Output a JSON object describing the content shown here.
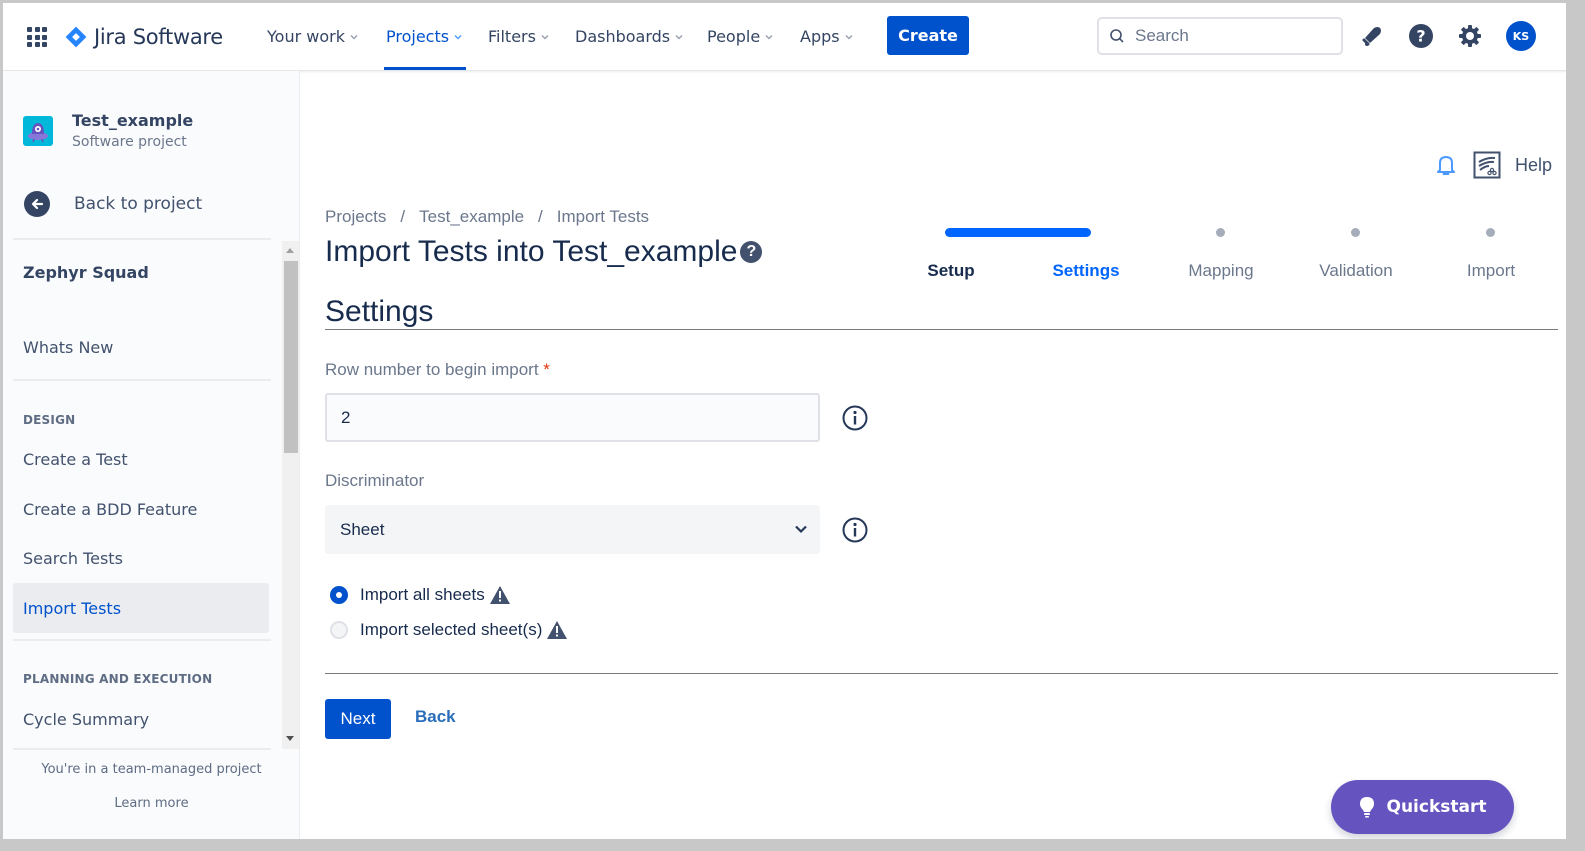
{
  "topnav": {
    "app_name": "Jira Software",
    "items": [
      {
        "label": "Your work",
        "active": false
      },
      {
        "label": "Projects",
        "active": true
      },
      {
        "label": "Filters",
        "active": false
      },
      {
        "label": "Dashboards",
        "active": false
      },
      {
        "label": "People",
        "active": false
      },
      {
        "label": "Apps",
        "active": false
      }
    ],
    "create_label": "Create",
    "search_placeholder": "Search",
    "icons": [
      "notifications-icon",
      "help-icon",
      "settings-icon"
    ],
    "avatar_initials": "KS",
    "accent_color": "#0052cc"
  },
  "sidebar": {
    "project_name": "Test_example",
    "project_type": "Software project",
    "back_label": "Back to project",
    "plugin_name": "Zephyr Squad",
    "whats_new": "Whats New",
    "sections": [
      {
        "heading": "DESIGN",
        "items": [
          "Create a Test",
          "Create a BDD Feature",
          "Search Tests",
          "Import Tests"
        ]
      },
      {
        "heading": "PLANNING AND EXECUTION",
        "items": [
          "Cycle Summary"
        ]
      }
    ],
    "active_item": "Import Tests",
    "footer_text": "You're in a team-managed project",
    "learn_more": "Learn more"
  },
  "main": {
    "help_label": "Help",
    "breadcrumb": [
      "Projects",
      "Test_example",
      "Import Tests"
    ],
    "breadcrumb_sep": "/",
    "title": "Import Tests into Test_example",
    "title_help_glyph": "?",
    "steps": [
      {
        "label": "Setup",
        "state": "done"
      },
      {
        "label": "Settings",
        "state": "current"
      },
      {
        "label": "Mapping",
        "state": "pending"
      },
      {
        "label": "Validation",
        "state": "pending"
      },
      {
        "label": "Import",
        "state": "pending"
      }
    ],
    "section_title": "Settings",
    "row_label": "Row number to begin import",
    "required_mark": "*",
    "row_value": "2",
    "discriminator_label": "Discriminator",
    "discriminator_value": "Sheet",
    "radio_options": [
      {
        "label": "Import all sheets",
        "selected": true
      },
      {
        "label": "Import selected sheet(s)",
        "selected": false
      }
    ],
    "next_label": "Next",
    "back_label": "Back",
    "quickstart_label": "Quickstart",
    "quickstart_color": "#6554c0"
  }
}
